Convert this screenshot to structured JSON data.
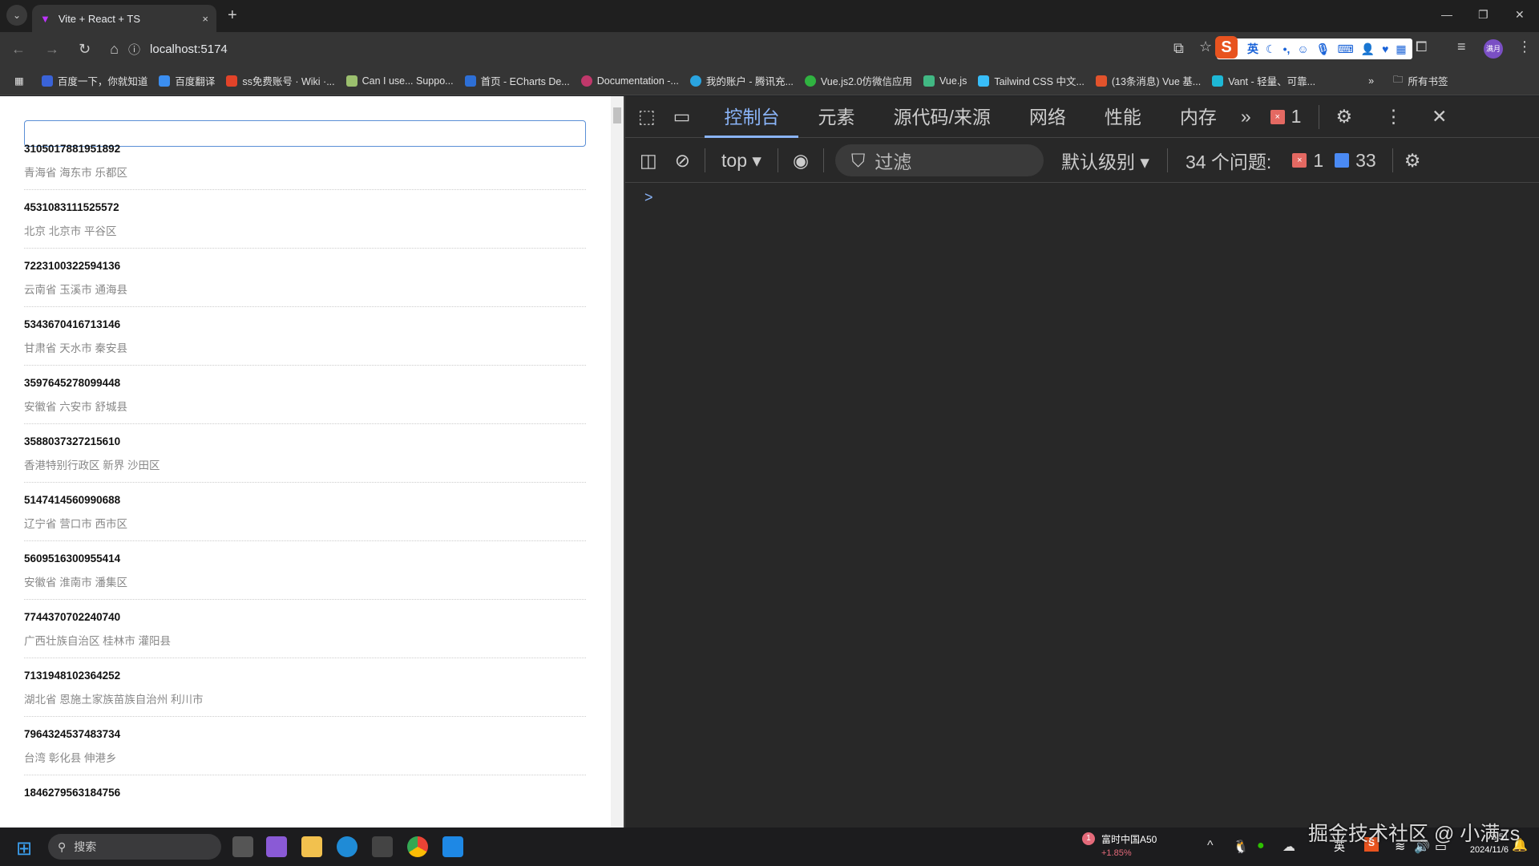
{
  "browser": {
    "tab_title": "Vite + React + TS",
    "url": "localhost:5174",
    "new_tab": "+",
    "close_tab": "×",
    "bookmarks": [
      "百度一下，你就知道",
      "百度翻译",
      "ss免费账号 · Wiki ·...",
      "Can I use... Suppo...",
      "首页 - ECharts De...",
      "Documentation -...",
      "我的账户 - 腾讯充...",
      "Vue.js2.0仿微信应用",
      "Vue.js",
      "Tailwind CSS 中文...",
      "(13条消息) Vue 基...",
      "Vant - 轻量、可靠..."
    ],
    "bookmarks_more": "»",
    "all_bookmarks": "所有书签",
    "ime_lang": "英",
    "profile": "满月"
  },
  "page": {
    "search_value": "",
    "items": [
      {
        "id": "3105017881951892",
        "address": "青海省 海东市 乐都区"
      },
      {
        "id": "4531083111525572",
        "address": "北京 北京市 平谷区"
      },
      {
        "id": "7223100322594136",
        "address": "云南省 玉溪市 通海县"
      },
      {
        "id": "5343670416713146",
        "address": "甘肃省 天水市 秦安县"
      },
      {
        "id": "3597645278099448",
        "address": "安徽省 六安市 舒城县"
      },
      {
        "id": "3588037327215610",
        "address": "香港特别行政区 新界 沙田区"
      },
      {
        "id": "5147414560990688",
        "address": "辽宁省 营口市 西市区"
      },
      {
        "id": "5609516300955414",
        "address": "安徽省 淮南市 潘集区"
      },
      {
        "id": "7744370702240740",
        "address": "广西壮族自治区 桂林市 灌阳县"
      },
      {
        "id": "7131948102364252",
        "address": "湖北省 恩施土家族苗族自治州 利川市"
      },
      {
        "id": "7964324537483734",
        "address": "台湾 彰化县 伸港乡"
      },
      {
        "id": "1846279563184756",
        "address": ""
      }
    ]
  },
  "devtools": {
    "tabs": [
      "控制台",
      "元素",
      "源代码/来源",
      "网络",
      "性能",
      "内存"
    ],
    "more": "»",
    "error_count": "1",
    "context": "top",
    "filter_placeholder": "过滤",
    "level": "默认级别",
    "issues_label": "34 个问题:",
    "issues_errors": "1",
    "issues_info": "33",
    "prompt": ">"
  },
  "taskbar": {
    "search": "搜索",
    "stock_name": "富时中国A50",
    "stock_change": "+1.85%",
    "stock_badge": "1",
    "ime": "英",
    "time": "2:51",
    "date": "2024/11/6"
  },
  "watermark": "掘金技术社区 @ 小满zs"
}
